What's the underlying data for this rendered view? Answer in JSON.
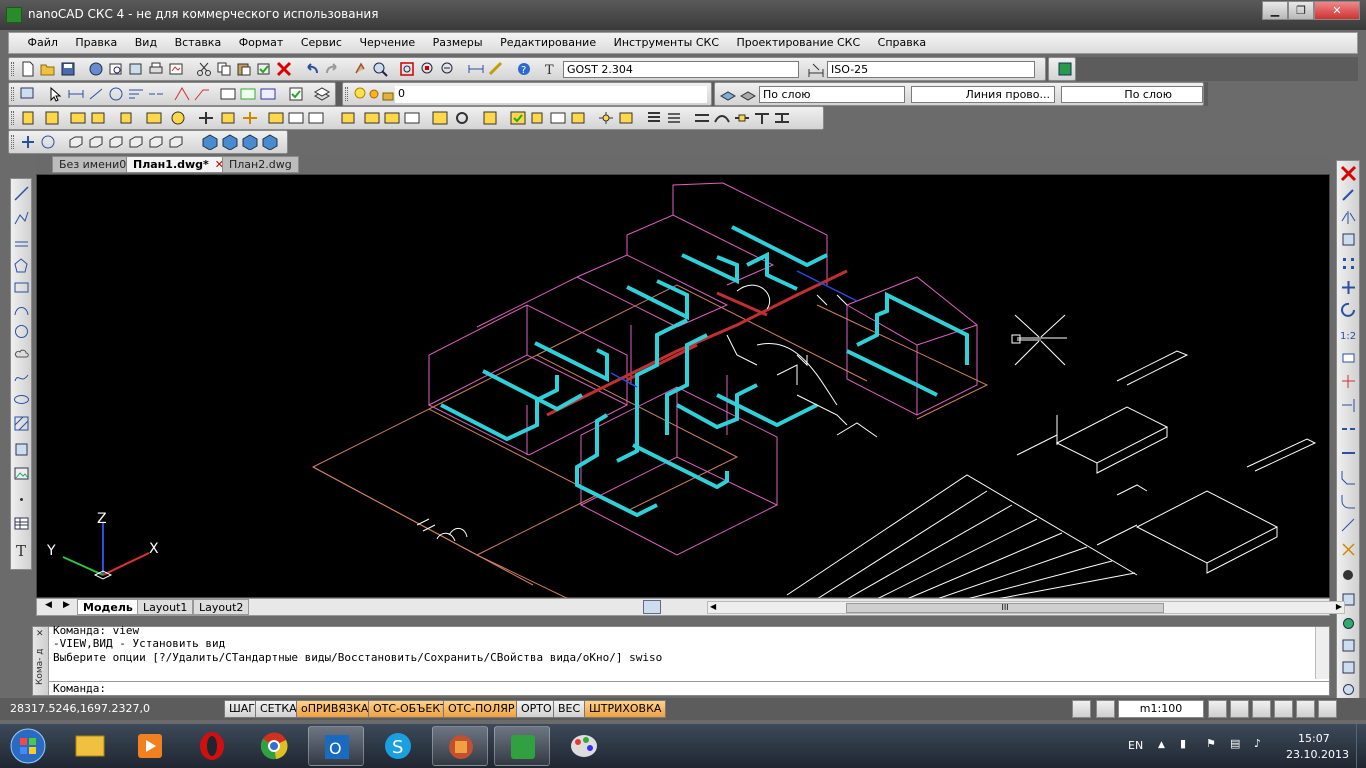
{
  "window": {
    "title": "nanoCAD СКС 4 - не для коммерческого использования",
    "minimize_glyph": "▁",
    "maximize_glyph": "❐",
    "close_glyph": "✕"
  },
  "menu": [
    "Файл",
    "Правка",
    "Вид",
    "Вставка",
    "Формат",
    "Сервис",
    "Черчение",
    "Размеры",
    "Редактирование",
    "Инструменты СКС",
    "Проектирование СКС",
    "Справка"
  ],
  "toolbar": {
    "text_style": "GOST 2.304",
    "dim_style": "ISO-25",
    "layer": "0",
    "color": "По слою",
    "linetype": "Линия прово...",
    "lineweight": "По слою"
  },
  "tabs": [
    {
      "label": "Без имени0",
      "active": false
    },
    {
      "label": "План1.dwg*",
      "active": true
    },
    {
      "label": "План2.dwg",
      "active": false
    }
  ],
  "layout_tabs": [
    "Модель",
    "Layout1",
    "Layout2"
  ],
  "active_layout": "Модель",
  "scroll_thumb": "III",
  "axis": {
    "x": "X",
    "y": "Y",
    "z": "Z"
  },
  "command_area": {
    "side_label": "Кома- д",
    "lines": [
      "Команда: view",
      "-VIEW,ВИД - Установить вид",
      "Выберите опции [?/Удалить/СТандартные виды/Восстановить/Сохранить/СВойства вида/оКно/] swiso"
    ],
    "prompt": "Команда:"
  },
  "status": {
    "coords": "28317.5246,1697.2327,0",
    "buttons": [
      {
        "label": "ШАГ",
        "on": false
      },
      {
        "label": "СЕТКА",
        "on": false
      },
      {
        "label": "оПРИВЯЗКА",
        "on": true
      },
      {
        "label": "ОТС-ОБЪЕКТ",
        "on": true
      },
      {
        "label": "ОТС-ПОЛЯР",
        "on": true
      },
      {
        "label": "ОРТО",
        "on": false
      },
      {
        "label": "ВЕС",
        "on": false
      },
      {
        "label": "ШТРИХОВКА",
        "on": true
      }
    ],
    "scale": "m1:100"
  },
  "taskbar": {
    "lang": "EN",
    "time": "15:07",
    "date": "23.10.2013",
    "apps": [
      "start",
      "explorer",
      "media-player",
      "opera",
      "chrome",
      "outlook",
      "skype",
      "nanocad",
      "network-tool",
      "paint"
    ]
  },
  "colors": {
    "canvas": "#000000",
    "walls": "#e060c0",
    "cable": "#2fd0d8",
    "tray": "#c03030",
    "floor": "#d08060"
  }
}
